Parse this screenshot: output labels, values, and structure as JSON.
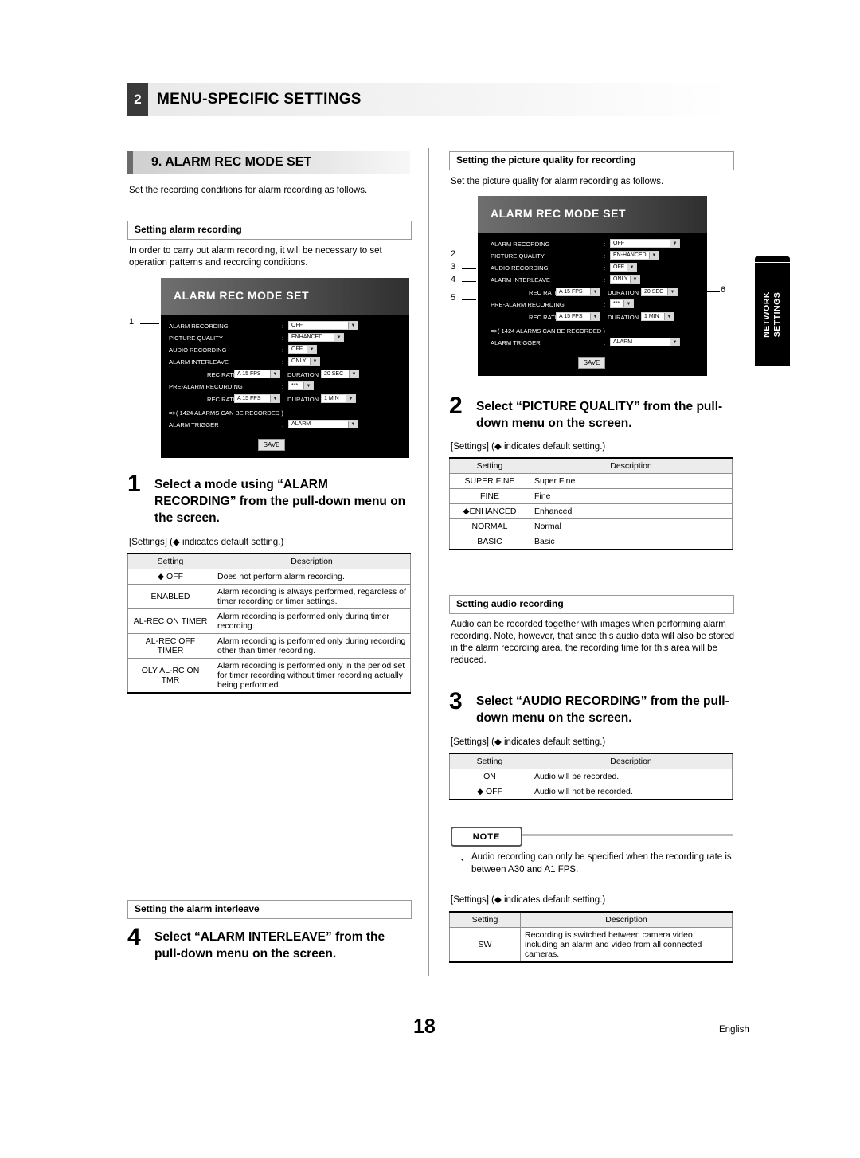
{
  "header": {
    "number": "2",
    "title": "MENU-SPECIFIC SETTINGS"
  },
  "section": {
    "title": "9. ALARM REC MODE SET",
    "intro": "Set the recording conditions for alarm recording as follows."
  },
  "left": {
    "sub1": "Setting alarm recording",
    "sub1_body": "In order to carry out alarm recording, it will be necessary to set operation patterns and recording conditions.",
    "screen": {
      "title": "ALARM REC MODE SET",
      "rows": [
        {
          "label": "ALARM RECORDING",
          "colon": ":",
          "value": "OFF"
        },
        {
          "label": "PICTURE QUALITY",
          "colon": ":",
          "value": "ENHANCED"
        },
        {
          "label": "AUDIO RECORDING",
          "colon": ":",
          "value": "OFF"
        },
        {
          "label": "ALARM INTERLEAVE",
          "colon": ":",
          "value": "ONLY"
        }
      ],
      "rec_rate_label": "REC RATE :",
      "rec_rate_value": "A 15 FPS",
      "duration_label": "DURATION :",
      "duration_value": "20 SEC",
      "prealarm_label": "PRE-ALARM RECORDING",
      "prealarm_colon": ":",
      "prealarm_value": "***",
      "rec_rate2_label": "REC RATE :",
      "rec_rate2_value": "A 15 FPS",
      "duration2_label": "DURATION :",
      "duration2_value": "1 MIN",
      "alarms_note": "=>( 1424 ALARMS CAN BE RECORDED )",
      "trigger_label": "ALARM TRIGGER",
      "trigger_colon": ":",
      "trigger_value": "ALARM",
      "save": "SAVE",
      "callout1": "1"
    },
    "step1": {
      "num": "1",
      "text": "Select a mode using “ALARM RECORDING” from the pull-down menu on the screen."
    },
    "settings_note": "[Settings] (◆ indicates default setting.)",
    "table1": {
      "headers": [
        "Setting",
        "Description"
      ],
      "rows": [
        {
          "setting": "◆ OFF",
          "desc": "Does not perform alarm recording."
        },
        {
          "setting": "ENABLED",
          "desc": "Alarm recording is always performed, regardless of timer recording or timer settings."
        },
        {
          "setting": "AL-REC ON TIMER",
          "desc": "Alarm recording is performed only during timer recording."
        },
        {
          "setting": "AL-REC OFF TIMER",
          "desc": "Alarm recording is performed only during recording other than timer recording."
        },
        {
          "setting": "OLY AL-RC ON TMR",
          "desc": "Alarm recording is performed only in the period set for timer recording without timer recording actually being performed."
        }
      ]
    },
    "sub2": "Setting the alarm interleave",
    "step4": {
      "num": "4",
      "text": "Select “ALARM INTERLEAVE” from the pull-down menu on the screen."
    }
  },
  "right": {
    "sub1": "Setting the picture quality for recording",
    "sub1_body": "Set the picture quality for alarm recording as follows.",
    "screen": {
      "title": "ALARM REC MODE SET",
      "rows": [
        {
          "label": "ALARM RECORDING",
          "colon": ":",
          "value": "OFF"
        },
        {
          "label": "PICTURE QUALITY",
          "colon": ":",
          "value": "EN-HANCED"
        },
        {
          "label": "AUDIO RECORDING",
          "colon": ":",
          "value": "OFF"
        },
        {
          "label": "ALARM INTERLEAVE",
          "colon": ":",
          "value": "ONLY"
        }
      ],
      "rec_rate_label": "REC RATE :",
      "rec_rate_value": "A 15 FPS",
      "duration_label": "DURATION :",
      "duration_value": "20 SEC",
      "prealarm_label": "PRE-ALARM RECORDING",
      "prealarm_colon": ":",
      "prealarm_value": "***",
      "rec_rate2_label": "REC RATE :",
      "rec_rate2_value": "A 15 FPS",
      "duration2_label": "DURATION :",
      "duration2_value": "1 MIN",
      "alarms_note": "=>( 1424 ALARMS CAN BE RECORDED )",
      "trigger_label": "ALARM TRIGGER",
      "trigger_colon": ":",
      "trigger_value": "ALARM",
      "save": "SAVE",
      "callout2": "2",
      "callout3": "3",
      "callout4": "4",
      "callout5": "5",
      "callout6": "6"
    },
    "step2": {
      "num": "2",
      "text": "Select “PICTURE QUALITY” from the pull-down menu on the screen."
    },
    "settings_note2": "[Settings] (◆ indicates default setting.)",
    "table2": {
      "headers": [
        "Setting",
        "Description"
      ],
      "rows": [
        {
          "setting": "SUPER FINE",
          "desc": "Super Fine"
        },
        {
          "setting": "FINE",
          "desc": "Fine"
        },
        {
          "setting": "◆ENHANCED",
          "desc": "Enhanced"
        },
        {
          "setting": "NORMAL",
          "desc": "Normal"
        },
        {
          "setting": "BASIC",
          "desc": "Basic"
        }
      ]
    },
    "sub2": "Setting audio recording",
    "sub2_body": "Audio can be recorded together with images when performing alarm recording. Note, however, that since this audio data will also be stored in the alarm recording area, the recording time for this area will be reduced.",
    "step3": {
      "num": "3",
      "text": "Select “AUDIO RECORDING” from the pull-down menu on the screen."
    },
    "settings_note3": "[Settings] (◆ indicates default setting.)",
    "table3": {
      "headers": [
        "Setting",
        "Description"
      ],
      "rows": [
        {
          "setting": "ON",
          "desc": "Audio will be recorded."
        },
        {
          "setting": "◆ OFF",
          "desc": "Audio will not be recorded."
        }
      ]
    },
    "note_label": "NOTE",
    "note_bullet": "Audio recording can only be specified when the recording rate is between A30 and A1 FPS.",
    "settings_note4": "[Settings] (◆ indicates default setting.)",
    "table4": {
      "headers": [
        "Setting",
        "Description"
      ],
      "rows": [
        {
          "setting": "SW",
          "desc": "Recording is switched between camera video including an alarm and video from all connected cameras."
        }
      ]
    }
  },
  "sidetab": {
    "line1": "NETWORK",
    "line2": "SETTINGS"
  },
  "footer": {
    "page": "18",
    "language": "English"
  }
}
